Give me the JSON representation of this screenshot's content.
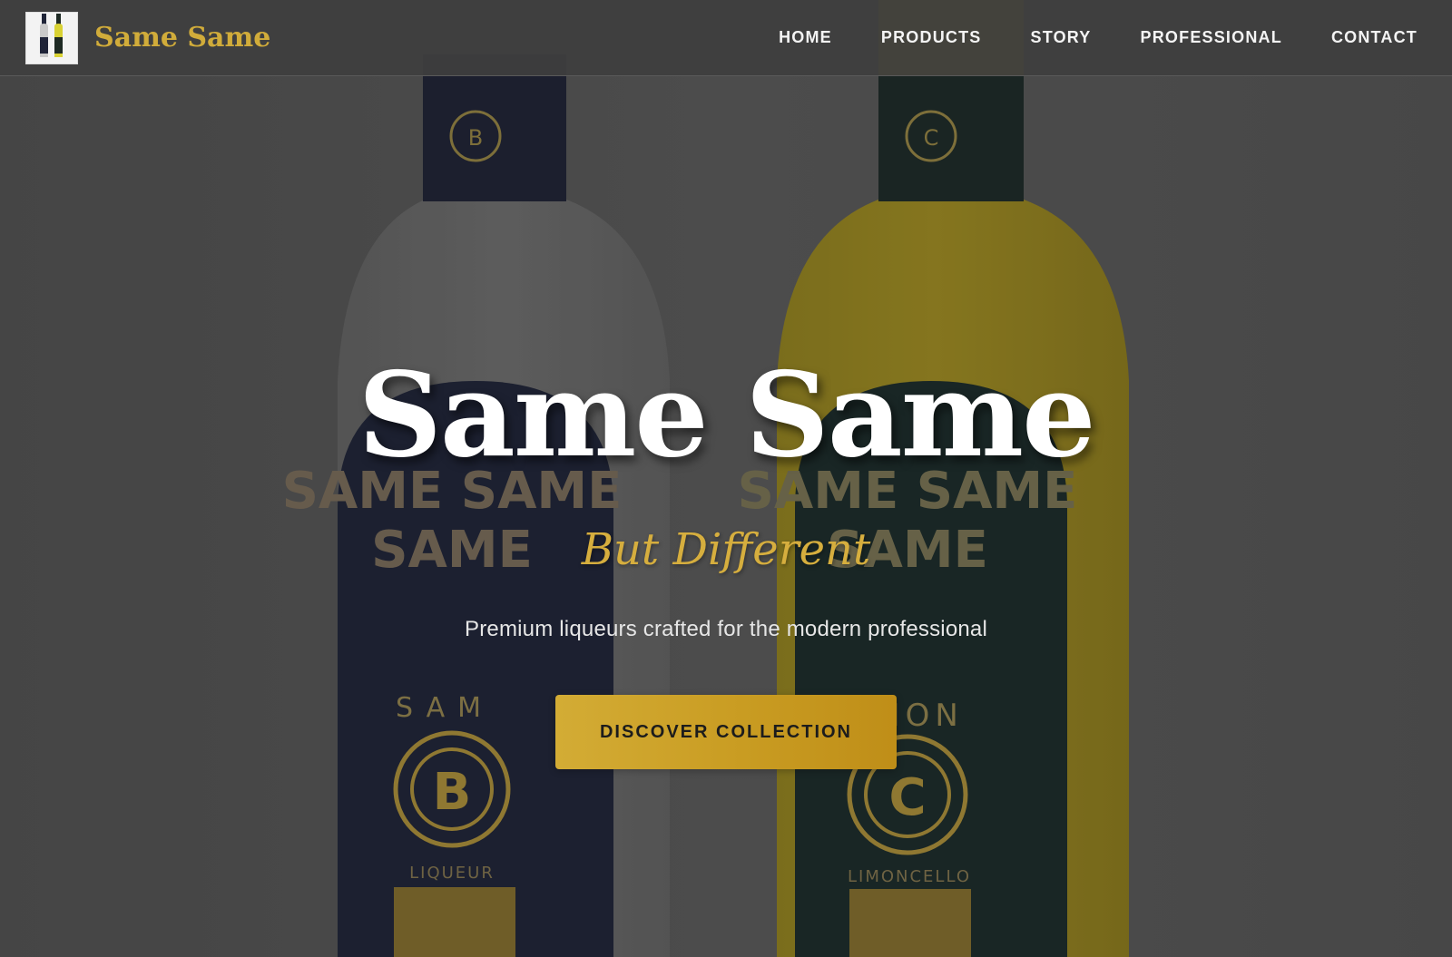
{
  "colors": {
    "accent_gold": "#d1ac3a",
    "nav_background": "#3e3e3e",
    "hero_overlay": "#4b4b4b",
    "title_white": "#ffffff",
    "button_gold": "#c99c22"
  },
  "nav": {
    "brand_name": "Same Same",
    "logo_icon": "bottles-logo-icon",
    "links": [
      {
        "label": "HOME"
      },
      {
        "label": "PRODUCTS"
      },
      {
        "label": "STORY"
      },
      {
        "label": "PROFESSIONAL"
      },
      {
        "label": "CONTACT"
      }
    ]
  },
  "hero": {
    "title": "Same Same",
    "subtitle": "But Different",
    "tagline": "Premium liqueurs crafted for the modern professional",
    "cta_label": "DISCOVER COLLECTION",
    "background": {
      "left_bottle": {
        "neck_text": "SAME SAME",
        "neck_letter": "B",
        "label_brand": "SAME SAME",
        "label_arc": "BUT DIFFERENT",
        "label_name": "SAM",
        "badge_letter": "B",
        "label_type": "LIQUEUR"
      },
      "right_bottle": {
        "neck_text": "SAME SAME",
        "neck_letter": "C",
        "label_brand": "SAME SAME",
        "label_arc": "BUT DIFFERENT",
        "label_name": "MON",
        "badge_letter": "C",
        "label_type": "LIMONCELLO"
      }
    }
  }
}
